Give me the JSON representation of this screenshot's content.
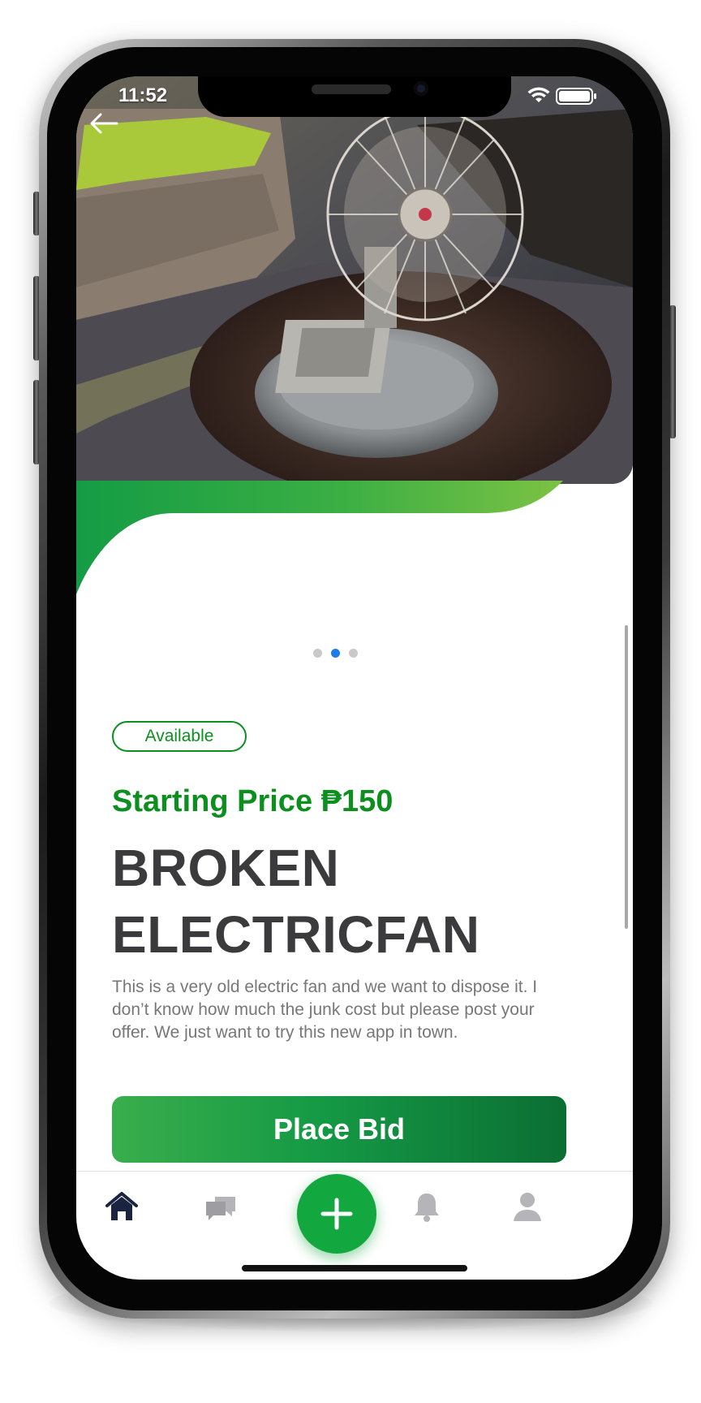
{
  "status_bar": {
    "time": "11:52"
  },
  "gallery": {
    "image_count": 3,
    "active_index": 1
  },
  "listing": {
    "status_badge": "Available",
    "price_text": "Starting Price ₱150",
    "title_line1": "BROKEN",
    "title_line2": "ELECTRICFAN",
    "description": "This is a very old electric fan and we want to dispose it. I don’t know how much the junk cost but please post your offer. We just want to try this new app in town."
  },
  "actions": {
    "place_bid_label": "Place Bid"
  },
  "tab_bar": {
    "items": [
      {
        "icon": "home-icon",
        "active": true
      },
      {
        "icon": "chat-icon",
        "active": false
      },
      {
        "icon": "add-icon",
        "active": false
      },
      {
        "icon": "bell-icon",
        "active": false
      },
      {
        "icon": "profile-icon",
        "active": false
      }
    ]
  },
  "colors": {
    "brand_green": "#0c8f1f",
    "wave_dark": "#149c45",
    "wave_light": "#7cc244",
    "active_dot": "#1f7be8",
    "active_tab": "#1a2340",
    "inactive_tab": "#b5b5b9",
    "title_text": "#3b3b3d"
  }
}
